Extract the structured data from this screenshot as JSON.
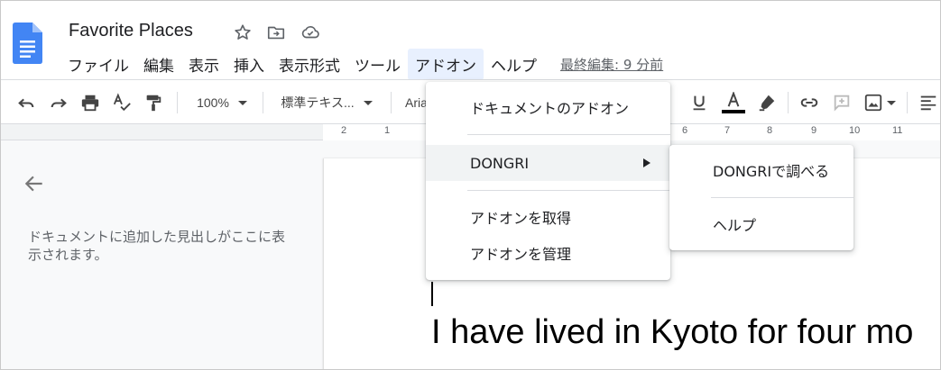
{
  "document": {
    "title": "Favorite Places"
  },
  "menubar": {
    "items": [
      "ファイル",
      "編集",
      "表示",
      "挿入",
      "表示形式",
      "ツール",
      "アドオン",
      "ヘルプ"
    ],
    "last_edit": "最終編集: 9 分前"
  },
  "toolbar": {
    "zoom": "100%",
    "style": "標準テキス...",
    "font": "Aria",
    "text_color": "#000000"
  },
  "ruler": {
    "labels": [
      "2",
      "1",
      "6",
      "7",
      "8",
      "9",
      "10",
      "11"
    ]
  },
  "outline": {
    "hint": "ドキュメントに追加した見出しがここに表示されます。"
  },
  "body": {
    "text": "I have lived in Kyoto for four mo"
  },
  "addons_menu": {
    "items": {
      "doc_addons": "ドキュメントのアドオン",
      "dongri": "DONGRI",
      "get_addons": "アドオンを取得",
      "manage_addons": "アドオンを管理"
    }
  },
  "dongri_submenu": {
    "items": {
      "lookup": "DONGRIで調べる",
      "help": "ヘルプ"
    }
  },
  "colors": {
    "brand_blue": "#4285f4",
    "menu_active": "#e8f0fe",
    "hover": "#f1f3f4"
  }
}
